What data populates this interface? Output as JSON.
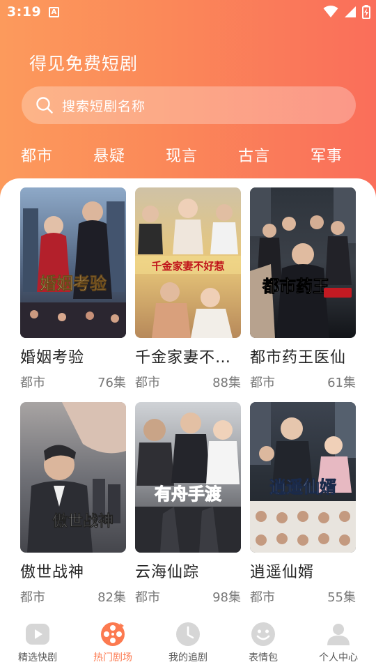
{
  "status": {
    "time": "3:19",
    "notification_glyph": "A"
  },
  "header": {
    "title": "得见免费短剧"
  },
  "search": {
    "placeholder": "搜索短剧名称"
  },
  "categories": [
    "都市",
    "悬疑",
    "现言",
    "古言",
    "军事"
  ],
  "dramas": [
    {
      "title": "婚姻考验",
      "genre": "都市",
      "episodes": "76集",
      "poster_text": "婚姻考验"
    },
    {
      "title": "千金家妻不好…",
      "genre": "都市",
      "episodes": "88集",
      "poster_text": "千金家妻不好惹"
    },
    {
      "title": "都市药王医仙",
      "genre": "都市",
      "episodes": "61集",
      "poster_text": "都市药王"
    },
    {
      "title": "傲世战神",
      "genre": "都市",
      "episodes": "82集",
      "poster_text": "傲世战神"
    },
    {
      "title": "云海仙踪",
      "genre": "都市",
      "episodes": "98集",
      "poster_text": "有舟手渡"
    },
    {
      "title": "逍遥仙婿",
      "genre": "都市",
      "episodes": "55集",
      "poster_text": "逍遥仙婿"
    }
  ],
  "bottom_nav": [
    {
      "label": "精选快剧",
      "icon": "play-icon",
      "active": false
    },
    {
      "label": "热门剧场",
      "icon": "film-reel-icon",
      "active": true
    },
    {
      "label": "我的追剧",
      "icon": "clock-icon",
      "active": false
    },
    {
      "label": "表情包",
      "icon": "smiley-icon",
      "active": false
    },
    {
      "label": "个人中心",
      "icon": "user-icon",
      "active": false
    }
  ],
  "colors": {
    "accent": "#fc7a50",
    "header_gradient_start": "#fc9a5c",
    "header_gradient_end": "#fa6e5a",
    "inactive_icon": "#d6d6d6"
  }
}
